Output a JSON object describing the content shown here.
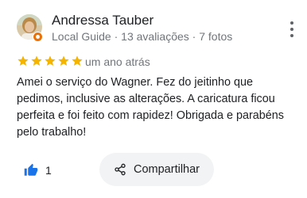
{
  "review": {
    "author": "Andressa Tauber",
    "author_meta": "Local Guide · 13 avaliações · 7 fotos",
    "rating": 5,
    "time": "um ano atrás",
    "text": "Amei o serviço do Wagner. Fez do jeitinho que pedimos, inclusive as alterações. A caricatura ficou perfeita e foi feito com rapidez! Obrigada e parabéns pelo trabalho!",
    "likes": "1",
    "share_label": "Compartilhar"
  },
  "colors": {
    "star": "#f4b400",
    "like_icon": "#1a73e8",
    "guide_badge": "#e8710a"
  },
  "icons": {
    "avatar": "user-photo",
    "badge": "local-guide-badge",
    "more": "more-vert-icon",
    "like": "thumb-up-icon",
    "share": "share-icon"
  }
}
